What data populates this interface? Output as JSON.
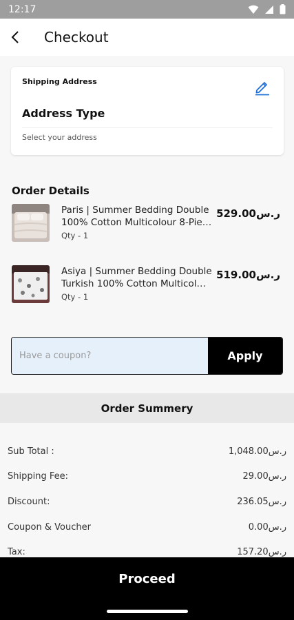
{
  "status": {
    "time": "12:17"
  },
  "header": {
    "title": "Checkout"
  },
  "shipping": {
    "label": "Shipping Address",
    "address_type": "Address Type",
    "hint": "Select your address"
  },
  "order_details": {
    "title": "Order Details",
    "items": [
      {
        "line1": "Paris | Summer Bedding Double",
        "line2": "100% Cotton Multicolour 8-Pie…",
        "qty": "Qty -  1",
        "price": "529.00ر.س"
      },
      {
        "line1": "Asiya | Summer Bedding Double",
        "line2": "Turkish 100% Cotton Multicol…",
        "qty": "Qty -  1",
        "price": "519.00ر.س"
      }
    ]
  },
  "coupon": {
    "placeholder": "Have a coupon?",
    "apply_label": "Apply"
  },
  "summary": {
    "title": "Order Summery",
    "rows": [
      {
        "label": "Sub Total :",
        "value": "1,048.00ر.س"
      },
      {
        "label": "Shipping Fee:",
        "value": "29.00ر.س"
      },
      {
        "label": "Discount:",
        "value": "236.05ر.س"
      },
      {
        "label": "Coupon & Voucher",
        "value": "0.00ر.س"
      },
      {
        "label": "Tax:",
        "value": "157.20ر.س"
      }
    ]
  },
  "footer": {
    "proceed_label": "Proceed"
  },
  "colors": {
    "accent": "#1f6fd6",
    "coupon_bg": "#e6f0fb",
    "button": "#000000"
  }
}
